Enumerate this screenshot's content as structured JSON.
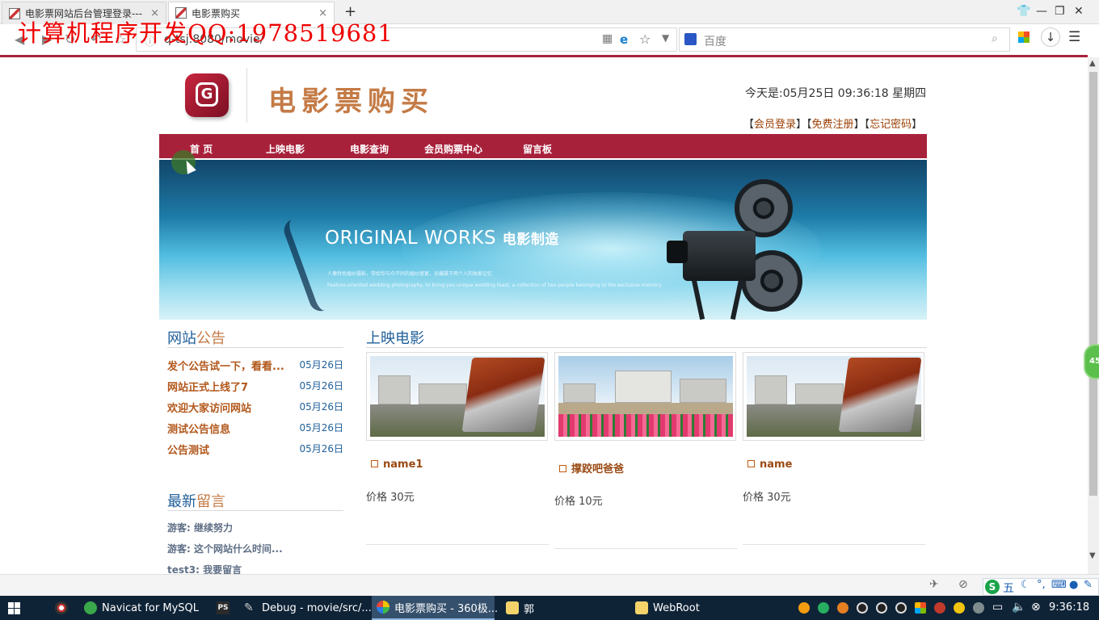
{
  "browser": {
    "tabs": [
      {
        "title": "电影票网站后台管理登录---",
        "close": "×"
      },
      {
        "title": "电影票购买",
        "close": "×"
      }
    ],
    "new_tab": "+",
    "url": "q-tsj:8080/movie/",
    "search_placeholder": "百度",
    "window_controls": {
      "skin": "👕",
      "minimize": "—",
      "restore": "❐",
      "close": "✕"
    }
  },
  "watermark": "计算机程序开发QQ:1978519681",
  "header": {
    "logo_letter": "G",
    "site_title": "电影票购买",
    "today": "今天是:05月25日  09:36:18   星期四",
    "auth": {
      "login": "会员登录",
      "register": "免费注册",
      "forgot": "忘记密码"
    }
  },
  "nav": [
    "首 页",
    "上映电影",
    "电影查询",
    "会员购票中心",
    "留言板"
  ],
  "banner": {
    "title": "ORIGINAL WORKS",
    "title_cn": "电影制造",
    "subtitle": "人像特色婚纱摄影，带给你与众不同的婚纱盛宴，珍藏属于两个人的独家记忆",
    "subtitle_en": "Feature-oriented wedding photography, to bring you unique wedding feast, a collection of two people belonging to the exclusive memory"
  },
  "notices": {
    "title_a": "网站",
    "title_b": "公告",
    "items": [
      {
        "title": "发个公告试一下，看看...",
        "date": "05月26日"
      },
      {
        "title": "网站正式上线了7",
        "date": "05月26日"
      },
      {
        "title": "欢迎大家访问网站",
        "date": "05月26日"
      },
      {
        "title": "测试公告信息",
        "date": "05月26日"
      },
      {
        "title": "公告测试",
        "date": "05月26日"
      }
    ]
  },
  "messages": {
    "title_a": "最新",
    "title_b": "留言",
    "items": [
      "游客: 继续努力",
      "游客: 这个网站什么时间...",
      "test3: 我要留言"
    ]
  },
  "movies": {
    "title": "上映电影",
    "items": [
      {
        "name": "name1",
        "price": "价格 30元",
        "image": "campus-abacus"
      },
      {
        "name": "撑跤吧爸爸",
        "price": "价格 10元",
        "image": "campus-flowers"
      },
      {
        "name": "name",
        "price": "价格 30元",
        "image": "campus-abacus"
      }
    ]
  },
  "side_badge": "45",
  "taskbar": {
    "items": [
      {
        "label": "Navicat for MySQL"
      },
      {
        "label": "Debug - movie/src/..."
      },
      {
        "label": "电影票购买 - 360极..."
      },
      {
        "label": "郭"
      },
      {
        "label": "WebRoot"
      }
    ],
    "clock": "9:36:18"
  },
  "ime": {
    "label": "五"
  },
  "colors": {
    "brand": "#a8213b",
    "title_blue": "#1f5f9a",
    "accent_orange": "#c47b46",
    "link_brown": "#b2571b"
  }
}
